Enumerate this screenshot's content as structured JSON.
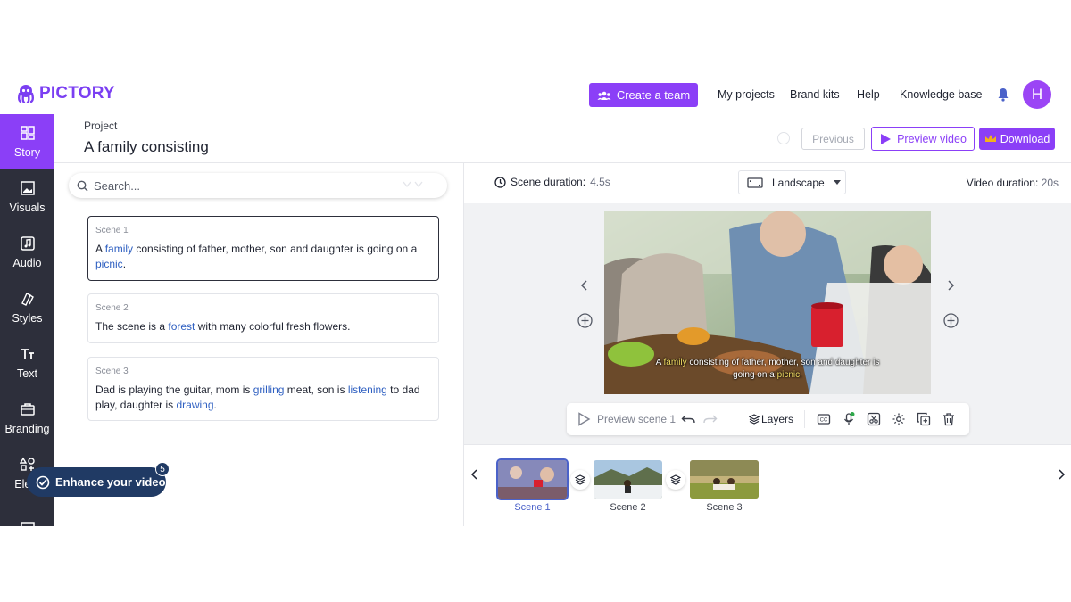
{
  "header": {
    "logo_text": "PICTORY",
    "create_team_label": "Create a team",
    "nav": [
      "My projects",
      "Brand kits",
      "Help",
      "Knowledge base"
    ],
    "avatar_initial": "H",
    "accent_color": "#8b3ff7"
  },
  "sidebar": {
    "items": [
      {
        "label": "Story",
        "icon": "story-grid-icon"
      },
      {
        "label": "Visuals",
        "icon": "image-icon"
      },
      {
        "label": "Audio",
        "icon": "music-note-icon"
      },
      {
        "label": "Styles",
        "icon": "styles-icon"
      },
      {
        "label": "Text",
        "icon": "text-icon"
      },
      {
        "label": "Branding",
        "icon": "briefcase-icon"
      },
      {
        "label": "Elem",
        "icon": "elements-icon"
      }
    ],
    "active": "Story"
  },
  "project": {
    "label": "Project",
    "title": "A family consisting",
    "previous_label": "Previous",
    "preview_label": "Preview video",
    "download_label": "Download"
  },
  "search": {
    "placeholder": "Search..."
  },
  "scenes": [
    {
      "label": "Scene 1",
      "parts": [
        {
          "t": "A "
        },
        {
          "t": "family",
          "kw": true
        },
        {
          "t": " consisting of father, mother, son and daughter is going on a "
        },
        {
          "t": "picnic",
          "kw": true
        },
        {
          "t": "."
        }
      ]
    },
    {
      "label": "Scene 2",
      "parts": [
        {
          "t": "The scene is a "
        },
        {
          "t": "forest",
          "kw": true
        },
        {
          "t": " with many colorful fresh flowers."
        }
      ]
    },
    {
      "label": "Scene 3",
      "parts": [
        {
          "t": "Dad is playing the guitar, mom is "
        },
        {
          "t": "grilling",
          "kw": true
        },
        {
          "t": " meat, son is "
        },
        {
          "t": "listening",
          "kw": true
        },
        {
          "t": " to dad play, daughter is "
        },
        {
          "t": "drawing",
          "kw": true
        },
        {
          "t": "."
        }
      ]
    }
  ],
  "editor": {
    "scene_duration_label": "Scene duration:",
    "scene_duration_value": "4.5s",
    "orientation": "Landscape",
    "video_duration_label": "Video duration:",
    "video_duration_value": "20s",
    "caption_parts": [
      {
        "t": "A "
      },
      {
        "t": "family",
        "hl": true
      },
      {
        "t": " consisting of father, mother, son and daughter is going on a "
      },
      {
        "t": "picnic",
        "hl": true
      },
      {
        "t": "."
      }
    ]
  },
  "toolbar": {
    "preview_scene_label": "Preview scene 1",
    "layers_label": "Layers"
  },
  "filmstrip": {
    "thumbs": [
      "Scene 1",
      "Scene 2",
      "Scene 3"
    ],
    "selected": "Scene 1"
  },
  "enhance": {
    "label": "Enhance your video",
    "badge": "5"
  }
}
